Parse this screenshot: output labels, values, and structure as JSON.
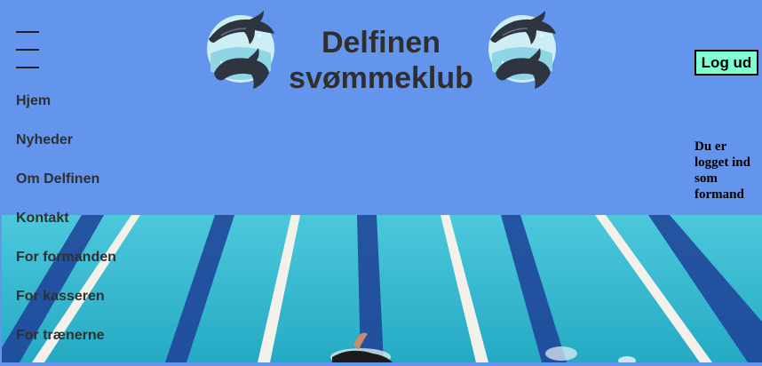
{
  "header": {
    "title_line1": "Delfinen",
    "title_line2": "svømmeklub",
    "logout_label": "Log ud",
    "logged_in_text": "Du er logget ind som formand"
  },
  "nav": {
    "items": [
      {
        "label": "Hjem"
      },
      {
        "label": "Nyheder"
      },
      {
        "label": "Om Delfinen"
      },
      {
        "label": "Kontakt"
      },
      {
        "label": "For formanden"
      },
      {
        "label": "For kasseren"
      },
      {
        "label": "For trænerne"
      }
    ]
  },
  "colors": {
    "header_bg": "#6495ed",
    "button_bg": "#7fffd4",
    "pool_water": "#2fb8d0",
    "lane_rope": "#f4f1ea",
    "lane_line": "#1a3a8f"
  },
  "icons": {
    "logo": "dolphins-logo-icon",
    "menu": "hamburger-menu-icon"
  }
}
